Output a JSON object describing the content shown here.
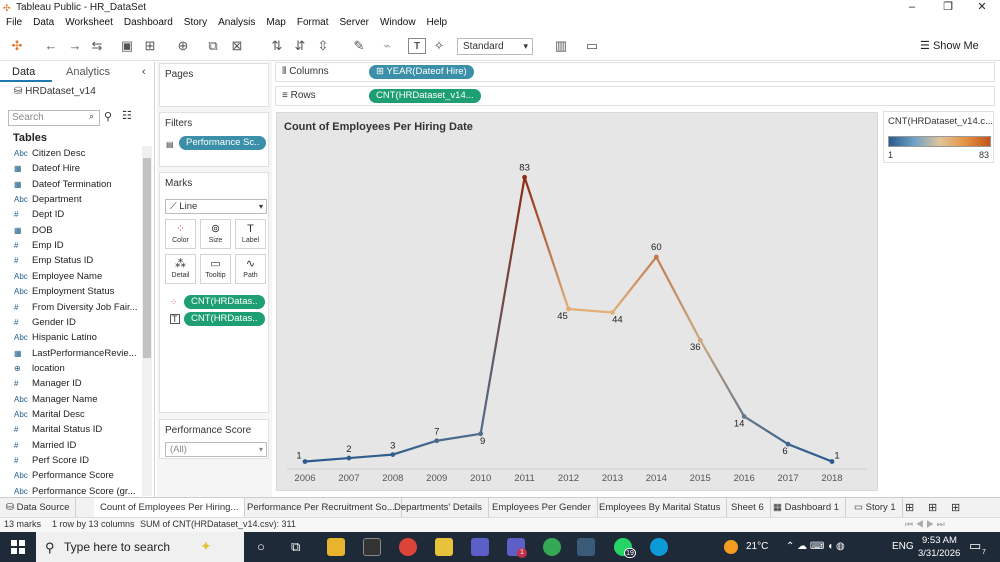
{
  "window": {
    "title": "Tableau Public - HR_DataSet"
  },
  "menu": [
    "File",
    "Data",
    "Worksheet",
    "Dashboard",
    "Story",
    "Analysis",
    "Map",
    "Format",
    "Server",
    "Window",
    "Help"
  ],
  "toolbar": {
    "view_mode": "Standard",
    "show_me": "Show Me"
  },
  "left_pane": {
    "tabs": [
      "Data",
      "Analytics"
    ],
    "datasource": "HRDataset_v14",
    "search_placeholder": "Search",
    "tables_heading": "Tables",
    "fields": [
      {
        "icon": "Abc",
        "name": "Citizen Desc"
      },
      {
        "icon": "cal",
        "name": "Dateof Hire"
      },
      {
        "icon": "cal",
        "name": "Dateof Termination"
      },
      {
        "icon": "Abc",
        "name": "Department"
      },
      {
        "icon": "#",
        "name": "Dept ID"
      },
      {
        "icon": "cal",
        "name": "DOB"
      },
      {
        "icon": "#",
        "name": "Emp ID"
      },
      {
        "icon": "#",
        "name": "Emp Status ID"
      },
      {
        "icon": "Abc",
        "name": "Employee Name"
      },
      {
        "icon": "Abc",
        "name": "Employment Status"
      },
      {
        "icon": "#",
        "name": "From Diversity Job Fair..."
      },
      {
        "icon": "#",
        "name": "Gender ID"
      },
      {
        "icon": "Abc",
        "name": "Hispanic Latino"
      },
      {
        "icon": "cal",
        "name": "LastPerformanceRevie..."
      },
      {
        "icon": "geo",
        "name": "location"
      },
      {
        "icon": "#",
        "name": "Manager ID"
      },
      {
        "icon": "Abc",
        "name": "Manager Name"
      },
      {
        "icon": "Abc",
        "name": "Marital Desc"
      },
      {
        "icon": "#",
        "name": "Marital Status ID"
      },
      {
        "icon": "#",
        "name": "Married ID"
      },
      {
        "icon": "#",
        "name": "Perf Score ID"
      },
      {
        "icon": "Abc",
        "name": "Performance Score"
      },
      {
        "icon": "Abc",
        "name": "Performance Score (gr..."
      }
    ]
  },
  "cards": {
    "pages": "Pages",
    "filters": {
      "heading": "Filters",
      "pill": "Performance Sc.."
    },
    "marks": {
      "heading": "Marks",
      "type": "Line",
      "buttons": [
        "Color",
        "Size",
        "Label",
        "Detail",
        "Tooltip",
        "Path"
      ],
      "pills": [
        "CNT(HRDatas..",
        "CNT(HRDatas.."
      ]
    },
    "quick_filter": {
      "heading": "Performance Score",
      "value": "(All)"
    }
  },
  "shelves": {
    "columns_label": "Columns",
    "columns_pill": "YEAR(Dateof Hire)",
    "rows_label": "Rows",
    "rows_pill": "CNT(HRDataset_v14..."
  },
  "legend": {
    "title": "CNT(HRDataset_v14.c...",
    "min": "1",
    "max": "83"
  },
  "chart_data": {
    "type": "line",
    "title": "Count of Employees Per Hiring Date",
    "xlabel": "",
    "ylabel": "",
    "categories": [
      "2006",
      "2007",
      "2008",
      "2009",
      "2010",
      "2011",
      "2012",
      "2013",
      "2014",
      "2015",
      "2016",
      "2017",
      "2018"
    ],
    "values": [
      1,
      2,
      3,
      7,
      9,
      83,
      45,
      44,
      60,
      36,
      14,
      6,
      1
    ],
    "ylim": [
      0,
      90
    ],
    "grid": false,
    "color_by_value": {
      "low": "#2b5a8e",
      "mid": "#e8b77e",
      "high": "#8e2b10"
    }
  },
  "sheet_tabs": [
    "Data Source",
    "Count of Employees Per Hiring...",
    "Performance Per Recruitment So...",
    "Departments' Details",
    "Employees Per Gender",
    "Employees By Marital Status",
    "Sheet 6",
    "Dashboard 1",
    "Story 1"
  ],
  "status": {
    "marks": "13 marks",
    "rows": "1 row by 13 columns",
    "sum": "SUM of CNT(HRDataset_v14.csv): 311"
  },
  "taskbar": {
    "search_placeholder": "Type here to search",
    "weather": "21°C",
    "lang": "ENG",
    "time": "9:53 AM",
    "date": "3/31/2026",
    "whatsapp_badge": "19",
    "teams_badge": "1",
    "notification_count": "7"
  }
}
